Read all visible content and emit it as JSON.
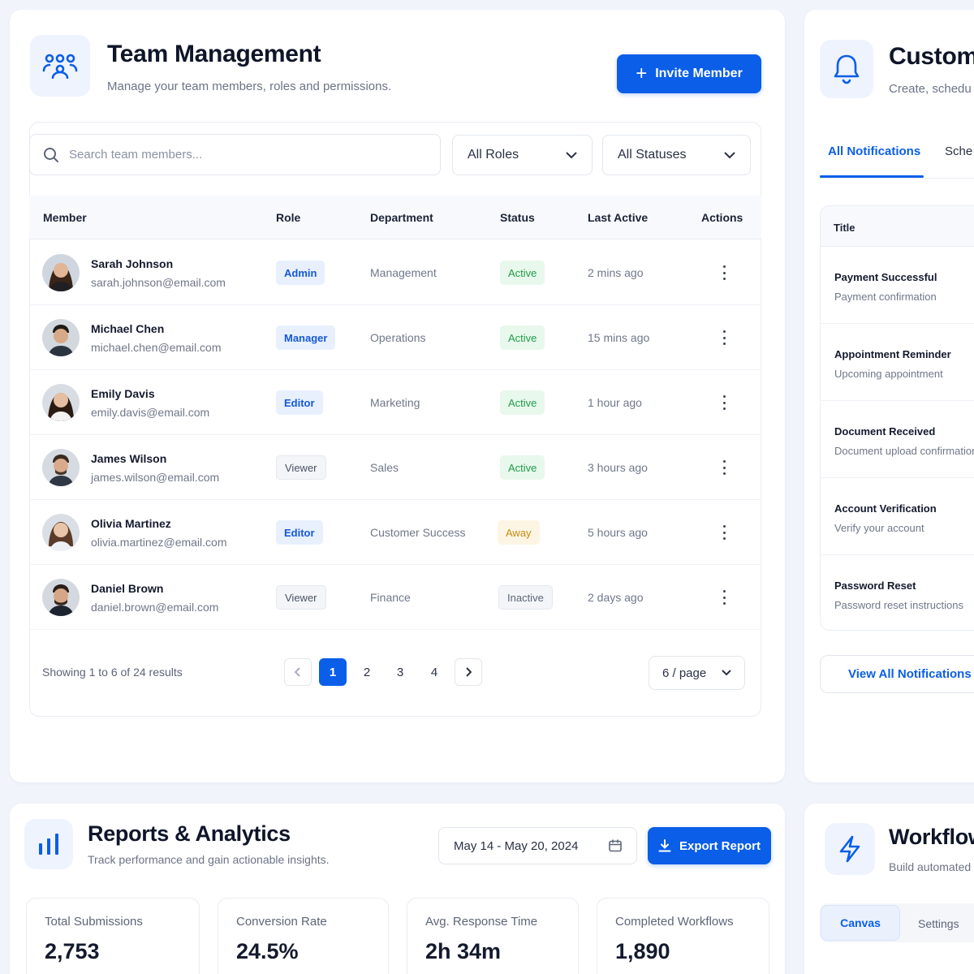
{
  "team": {
    "title": "Team Management",
    "subtitle": "Manage your team members, roles and permissions.",
    "invite_label": "Invite Member",
    "search_placeholder": "Search team members...",
    "role_filter": "All Roles",
    "status_filter": "All Statuses",
    "columns": [
      "Member",
      "Role",
      "Department",
      "Status",
      "Last Active",
      "Actions"
    ],
    "members": [
      {
        "name": "Sarah Johnson",
        "email": "sarah.johnson@email.com",
        "role": "Admin",
        "department": "Management",
        "status": "Active",
        "last_active": "2 mins ago"
      },
      {
        "name": "Michael Chen",
        "email": "michael.chen@email.com",
        "role": "Manager",
        "department": "Operations",
        "status": "Active",
        "last_active": "15 mins ago"
      },
      {
        "name": "Emily Davis",
        "email": "emily.davis@email.com",
        "role": "Editor",
        "department": "Marketing",
        "status": "Active",
        "last_active": "1 hour ago"
      },
      {
        "name": "James Wilson",
        "email": "james.wilson@email.com",
        "role": "Viewer",
        "department": "Sales",
        "status": "Active",
        "last_active": "3 hours ago"
      },
      {
        "name": "Olivia Martinez",
        "email": "olivia.martinez@email.com",
        "role": "Editor",
        "department": "Customer Success",
        "status": "Away",
        "last_active": "5 hours ago"
      },
      {
        "name": "Daniel Brown",
        "email": "daniel.brown@email.com",
        "role": "Viewer",
        "department": "Finance",
        "status": "Inactive",
        "last_active": "2 days ago"
      }
    ],
    "pagination": {
      "summary": "Showing 1 to 6 of 24 results",
      "pages": [
        "1",
        "2",
        "3",
        "4"
      ],
      "current_page": "1",
      "page_size": "6 / page"
    }
  },
  "notifications": {
    "title": "Custom",
    "subtitle": "Create, schedu",
    "tabs": [
      "All Notifications",
      "Sche"
    ],
    "column_title": "Title",
    "items": [
      {
        "title": "Payment Successful",
        "subtitle": "Payment confirmation"
      },
      {
        "title": "Appointment Reminder",
        "subtitle": "Upcoming appointment"
      },
      {
        "title": "Document Received",
        "subtitle": "Document upload confirmation"
      },
      {
        "title": "Account Verification",
        "subtitle": "Verify your account"
      },
      {
        "title": "Password Reset",
        "subtitle": "Password reset instructions"
      }
    ],
    "view_all_label": "View All Notifications"
  },
  "reports": {
    "title": "Reports & Analytics",
    "subtitle": "Track performance and gain actionable insights.",
    "date_range": "May 14 - May 20, 2024",
    "export_label": "Export Report",
    "stats": [
      {
        "label": "Total Submissions",
        "value": "2,753"
      },
      {
        "label": "Conversion Rate",
        "value": "24.5%"
      },
      {
        "label": "Avg. Response Time",
        "value": "2h 34m"
      },
      {
        "label": "Completed Workflows",
        "value": "1,890"
      }
    ]
  },
  "workflow": {
    "title": "Workflow",
    "subtitle": "Build automated",
    "tabs": [
      "Canvas",
      "Settings"
    ]
  },
  "colors": {
    "primary": "#0a5ee8",
    "active": "#1f9d48",
    "away": "#c98a12",
    "background": "#f1f4fa"
  }
}
